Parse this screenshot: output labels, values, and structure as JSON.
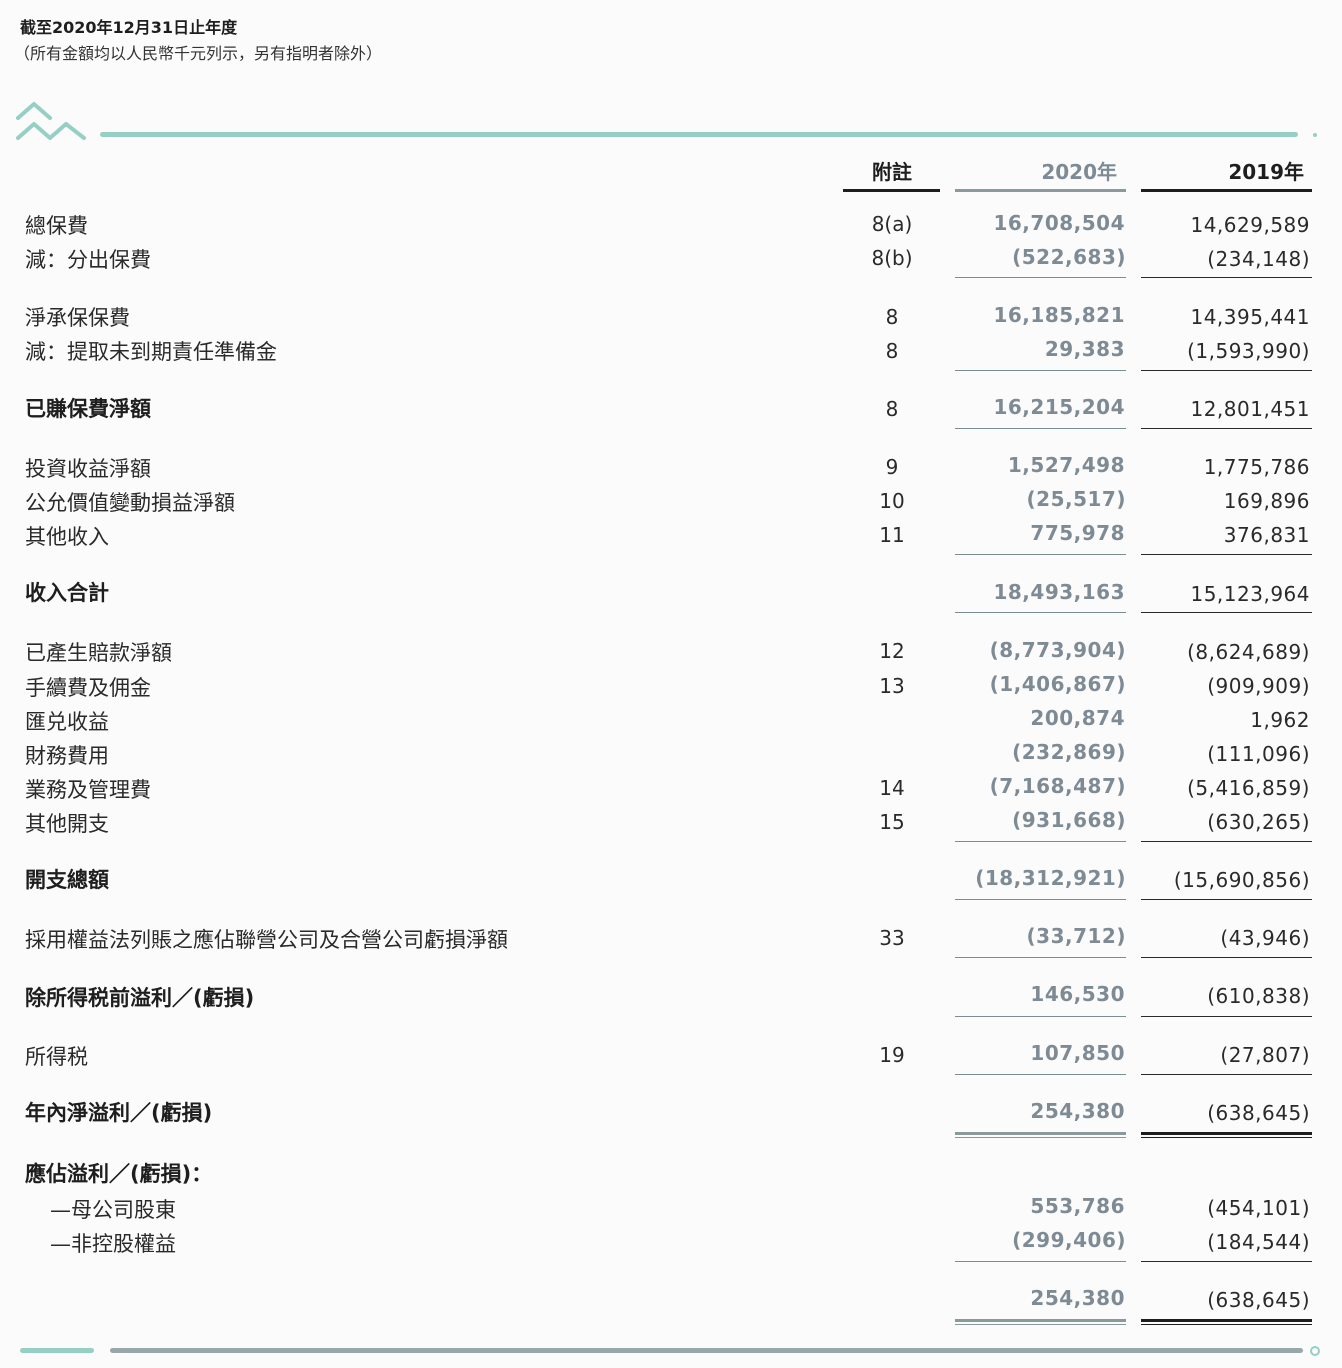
{
  "header": {
    "period": "截至2020年12月31日止年度",
    "currency_note": "（所有金額均以人民幣千元列示，另有指明者除外）"
  },
  "columns": {
    "note": "附註",
    "y2020": "2020年",
    "y2019": "2019年"
  },
  "rows": [
    {
      "label": "總保費",
      "note": "8(a)",
      "v2020": "16,708,504",
      "v2019": "14,629,589"
    },
    {
      "label": "減：分出保費",
      "note": "8(b)",
      "v2020": "(522,683)",
      "v2019": "(234,148)"
    },
    {
      "label": "淨承保保費",
      "note": "8",
      "v2020": "16,185,821",
      "v2019": "14,395,441"
    },
    {
      "label": "減：提取未到期責任準備金",
      "note": "8",
      "v2020": "29,383",
      "v2019": "(1,593,990)"
    },
    {
      "label": "已賺保費淨額",
      "note": "8",
      "v2020": "16,215,204",
      "v2019": "12,801,451"
    },
    {
      "label": "投資收益淨額",
      "note": "9",
      "v2020": "1,527,498",
      "v2019": "1,775,786"
    },
    {
      "label": "公允價值變動損益淨額",
      "note": "10",
      "v2020": "(25,517)",
      "v2019": "169,896"
    },
    {
      "label": "其他收入",
      "note": "11",
      "v2020": "775,978",
      "v2019": "376,831"
    },
    {
      "label": "收入合計",
      "note": "",
      "v2020": "18,493,163",
      "v2019": "15,123,964"
    },
    {
      "label": "已產生賠款淨額",
      "note": "12",
      "v2020": "(8,773,904)",
      "v2019": "(8,624,689)"
    },
    {
      "label": "手續費及佣金",
      "note": "13",
      "v2020": "(1,406,867)",
      "v2019": "(909,909)"
    },
    {
      "label": "匯兑收益",
      "note": "",
      "v2020": "200,874",
      "v2019": "1,962"
    },
    {
      "label": "財務費用",
      "note": "",
      "v2020": "(232,869)",
      "v2019": "(111,096)"
    },
    {
      "label": "業務及管理費",
      "note": "14",
      "v2020": "(7,168,487)",
      "v2019": "(5,416,859)"
    },
    {
      "label": "其他開支",
      "note": "15",
      "v2020": "(931,668)",
      "v2019": "(630,265)"
    },
    {
      "label": "開支總額",
      "note": "",
      "v2020": "(18,312,921)",
      "v2019": "(15,690,856)"
    },
    {
      "label": "採用權益法列賬之應佔聯營公司及合營公司虧損淨額",
      "note": "33",
      "v2020": "(33,712)",
      "v2019": "(43,946)"
    },
    {
      "label": "除所得税前溢利／(虧損)",
      "note": "",
      "v2020": "146,530",
      "v2019": "(610,838)"
    },
    {
      "label": "所得税",
      "note": "19",
      "v2020": "107,850",
      "v2019": "(27,807)"
    },
    {
      "label": "年內淨溢利／(虧損)",
      "note": "",
      "v2020": "254,380",
      "v2019": "(638,645)"
    },
    {
      "label": "應佔溢利／(虧損)：",
      "note": "",
      "v2020": "",
      "v2019": ""
    },
    {
      "label": "—母公司股東",
      "note": "",
      "v2020": "553,786",
      "v2019": "(454,101)"
    },
    {
      "label": "—非控股權益",
      "note": "",
      "v2020": "(299,406)",
      "v2019": "(184,544)"
    },
    {
      "label": "",
      "note": "",
      "v2020": "254,380",
      "v2019": "(638,645)"
    }
  ]
}
